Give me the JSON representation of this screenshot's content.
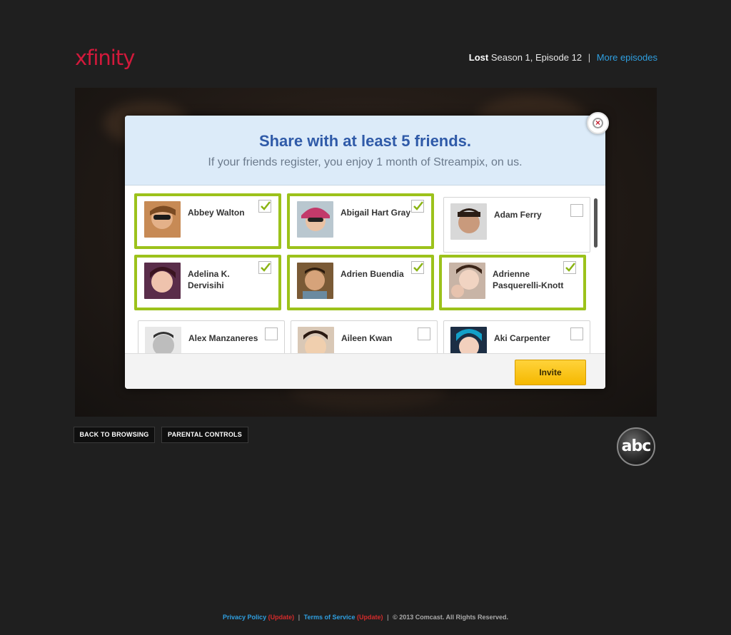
{
  "header": {
    "logo": "xfinity",
    "show_name": "Lost",
    "episode": "Season 1, Episode 12",
    "separator": "|",
    "more_episodes": "More episodes"
  },
  "modal": {
    "title": "Share with at least 5 friends.",
    "subtitle": "If your friends register, you enjoy 1 month of Streampix, on us.",
    "close_icon": "close-icon",
    "invite_label": "Invite",
    "friends": [
      {
        "name": "Abbey Walton",
        "selected": true
      },
      {
        "name": "Abigail Hart Gray",
        "selected": true
      },
      {
        "name": "Adam Ferry",
        "selected": false
      },
      {
        "name": "Adelina K. Dervisihi",
        "selected": true
      },
      {
        "name": "Adrien Buendia",
        "selected": true
      },
      {
        "name": "Adrienne Pasquerelli-Knott",
        "selected": true
      },
      {
        "name": "Alex Manzaneres",
        "selected": false
      },
      {
        "name": "Aileen Kwan",
        "selected": false
      },
      {
        "name": "Aki Carpenter",
        "selected": false
      }
    ]
  },
  "controls": {
    "back_to_browsing": "BACK TO BROWSING",
    "parental_controls": "PARENTAL CONTROLS",
    "network_logo": "abc"
  },
  "footer": {
    "privacy": "Privacy Policy",
    "update1": "(Update)",
    "terms": "Terms of Service",
    "update2": "(Update)",
    "bar1": "|",
    "bar2": "|",
    "copyright": "© 2013 Comcast. All Rights Reserved."
  },
  "colors": {
    "brand_red": "#d2193b",
    "link_blue": "#2f9fe0",
    "selected_green": "#9cc21b",
    "invite_yellow": "#f5b800",
    "title_blue": "#2f5aa8"
  }
}
